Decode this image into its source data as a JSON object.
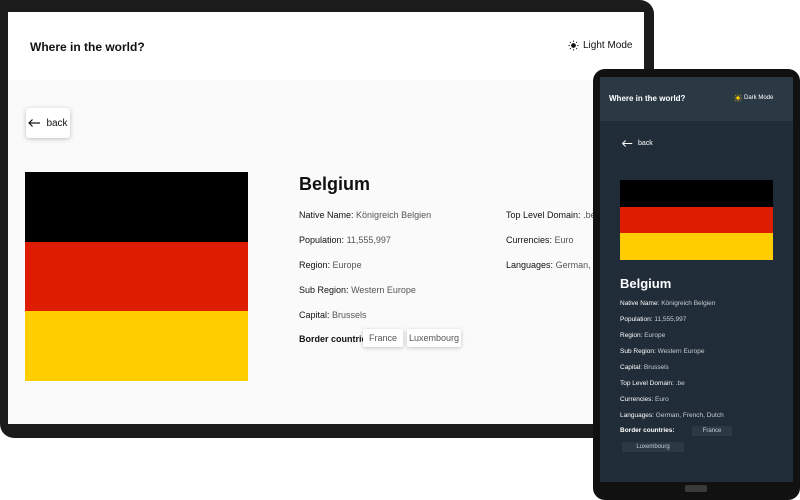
{
  "app_title": "Where in the world?",
  "light_view": {
    "mode_label": "Light Mode"
  },
  "dark_view": {
    "mode_label": "Dark Mode"
  },
  "back_label": "back",
  "country": {
    "name": "Belgium",
    "native_name_label": "Native Name:",
    "native_name": "Königreich Belgien",
    "population_label": "Population:",
    "population": "11,555,997",
    "region_label": "Region:",
    "region": "Europe",
    "sub_region_label": "Sub Region:",
    "sub_region": "Western Europe",
    "capital_label": "Capital:",
    "capital": "Brussels",
    "tld_label": "Top Level Domain:",
    "tld": ".be",
    "currencies_label": "Currencies:",
    "currencies": "Euro",
    "languages_label": "Languages:",
    "languages": "German, French",
    "languages_mobile": "German, French, Dutch",
    "border_label": "Border countries:",
    "borders": [
      "France",
      "Luxembourg"
    ]
  },
  "flag_colors": [
    "#000000",
    "#dd1c00",
    "#ffcd00"
  ],
  "colors": {
    "light_bg": "#fafafa",
    "light_element": "#ffffff",
    "dark_bg": "#202c37",
    "dark_element": "#2b3945"
  },
  "icons": {
    "light_mode_icon": "sun-dark-icon",
    "dark_mode_icon": "sun-icon",
    "back_icon": "arrow-left-icon"
  }
}
